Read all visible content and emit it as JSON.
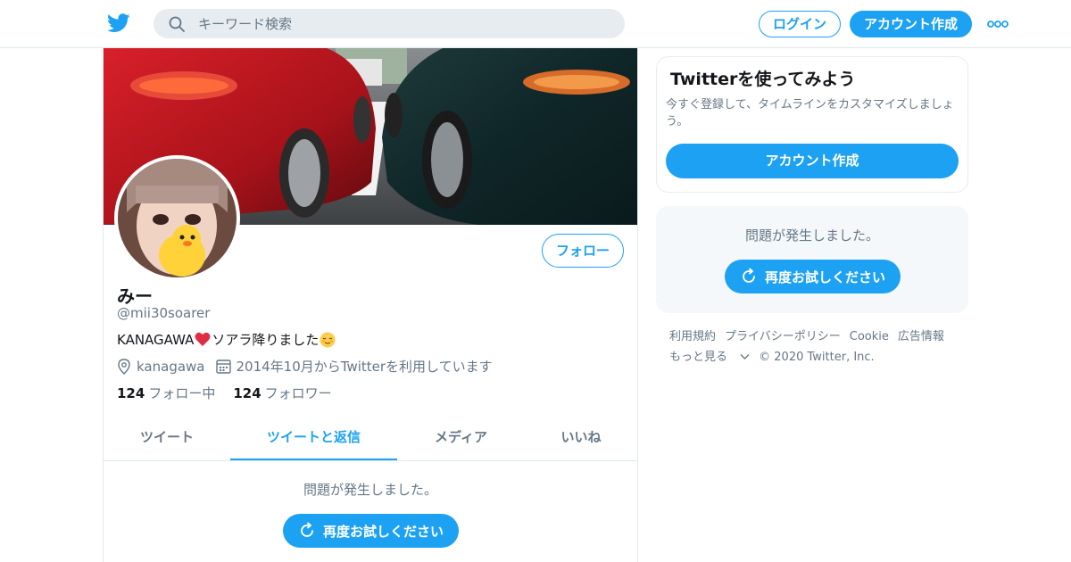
{
  "header": {
    "search_placeholder": "キーワード検索",
    "login_label": "ログイン",
    "signup_label": "アカウント作成",
    "accent_color": "#1da1f2"
  },
  "profile": {
    "name": "みー",
    "handle": "@mii30soarer",
    "bio_prefix": "KANAGAWA",
    "bio_suffix": "ソアラ降りました",
    "location": "kanagawa",
    "joined": "2014年10月からTwitterを利用しています",
    "following_count": "124",
    "following_label": "フォロー中",
    "followers_count": "124",
    "followers_label": "フォロワー",
    "follow_label": "フォロー"
  },
  "tabs": [
    {
      "label": "ツイート",
      "active": false
    },
    {
      "label": "ツイートと返信",
      "active": true
    },
    {
      "label": "メディア",
      "active": false
    },
    {
      "label": "いいね",
      "active": false
    }
  ],
  "timeline": {
    "error_message": "問題が発生しました。",
    "retry_label": "再度お試しください"
  },
  "sidebar": {
    "promo_title": "Twitterを使ってみよう",
    "promo_desc": "今すぐ登録して、タイムラインをカスタマイズしましょう。",
    "promo_signup_label": "アカウント作成",
    "error_message": "問題が発生しました。",
    "retry_label": "再度お試しください"
  },
  "footer": {
    "links": [
      "利用規約",
      "プライバシーポリシー",
      "Cookie",
      "広告情報"
    ],
    "more_label": "もっと見る",
    "copyright": "© 2020 Twitter, Inc."
  }
}
